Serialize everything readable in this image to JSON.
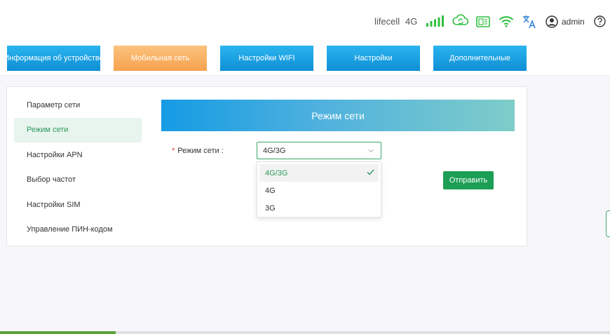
{
  "header": {
    "operator": "lifecell",
    "network_type": "4G",
    "user": "admin",
    "icons": [
      "signal-icon",
      "cloud-sync-icon",
      "sim-card-icon",
      "wifi-icon",
      "language-icon",
      "user-avatar-icon",
      "help-icon"
    ],
    "accent_color": "#2fbf3f"
  },
  "nav": {
    "tabs": [
      {
        "label": "Информация об устройстве",
        "active": false
      },
      {
        "label": "Мобильная сеть",
        "active": true
      },
      {
        "label": "Настройки WIFI",
        "active": false
      },
      {
        "label": "Настройки",
        "active": false
      },
      {
        "label": "Дополнительные",
        "active": false
      }
    ]
  },
  "sidebar": {
    "items": [
      {
        "label": "Параметр сети",
        "active": false
      },
      {
        "label": "Режим сети",
        "active": true
      },
      {
        "label": "Настройки APN",
        "active": false
      },
      {
        "label": "Выбор частот",
        "active": false
      },
      {
        "label": "Настройки SIM",
        "active": false
      },
      {
        "label": "Управление ПИН-кодом",
        "active": false
      }
    ]
  },
  "main": {
    "title": "Режим сети",
    "field_label": "Режим сети :",
    "required_mark": "*",
    "selected_value": "4G/3G",
    "submit_label": "Отправить",
    "options": [
      {
        "label": "4G/3G",
        "selected": true
      },
      {
        "label": "4G",
        "selected": false
      },
      {
        "label": "3G",
        "selected": false
      }
    ]
  },
  "colors": {
    "tab_active": "#f7a250",
    "tab_inactive": "#1aa0e0",
    "primary_green": "#1c9e55"
  },
  "page_load_progress": 0.19
}
